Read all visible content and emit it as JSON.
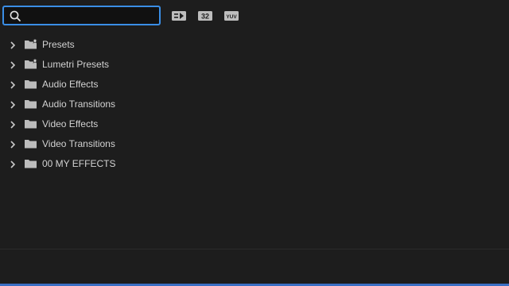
{
  "search": {
    "value": "",
    "placeholder": ""
  },
  "toolbar": {
    "buttons": [
      {
        "icon": "accelerated-effects-icon",
        "label": ""
      },
      {
        "icon": "32-bit-color-icon",
        "label": "32"
      },
      {
        "icon": "yuv-effects-icon",
        "label": "YUV"
      }
    ]
  },
  "tree": {
    "items": [
      {
        "label": "Presets",
        "icon": "preset-folder-icon"
      },
      {
        "label": "Lumetri Presets",
        "icon": "preset-folder-icon"
      },
      {
        "label": "Audio Effects",
        "icon": "folder-icon"
      },
      {
        "label": "Audio Transitions",
        "icon": "folder-icon"
      },
      {
        "label": "Video Effects",
        "icon": "folder-icon"
      },
      {
        "label": "Video Transitions",
        "icon": "folder-icon"
      },
      {
        "label": "00 MY EFFECTS",
        "icon": "folder-icon"
      }
    ]
  },
  "colors": {
    "background": "#1d1d1d",
    "focus_accent": "#3a8ee6",
    "text": "#d2d2d2",
    "icon": "#bcbcbc"
  }
}
